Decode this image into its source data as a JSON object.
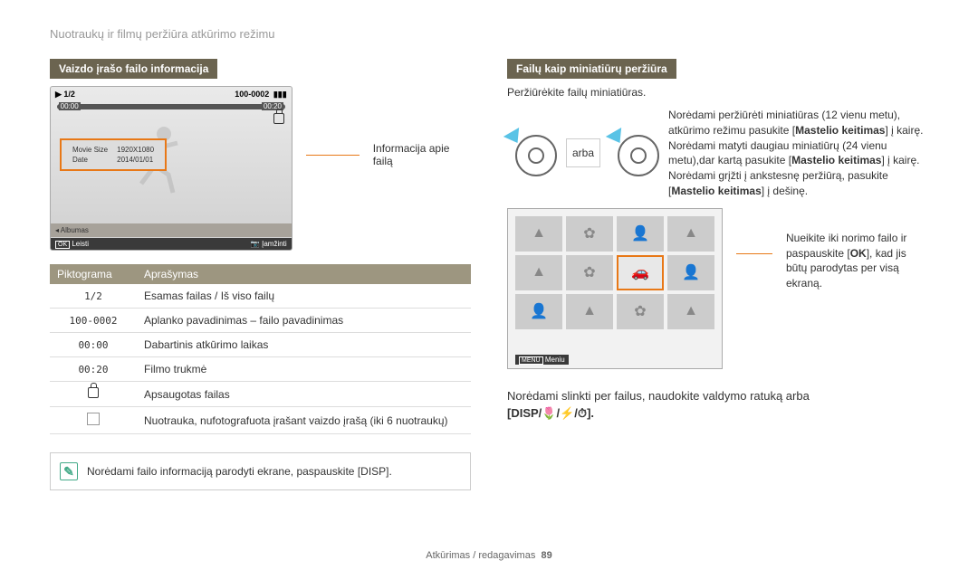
{
  "breadcrumb": "Nuotraukų ir filmų peržiūra atkūrimo režimu",
  "left": {
    "title": "Vaizdo įrašo failo informacija",
    "lcd": {
      "counter": "1/2",
      "file": "100-0002",
      "time_l": "00:00",
      "time_r": "00:20",
      "info_size_label": "Movie Size",
      "info_size_val": "1920X1080",
      "info_date_label": "Date",
      "info_date_val": "2014/01/01",
      "album": "Albumas",
      "play": "Leisti",
      "capture": "Įamžinti"
    },
    "leader": "Informacija apie failą",
    "table": {
      "h1": "Piktograma",
      "h2": "Aprašymas",
      "rows": [
        {
          "icon": "1/2",
          "desc": "Esamas failas / Iš viso failų"
        },
        {
          "icon": "100-0002",
          "desc": "Aplanko pavadinimas – failo pavadinimas"
        },
        {
          "icon": "00:00",
          "desc": "Dabartinis atkūrimo laikas"
        },
        {
          "icon": "00:20",
          "desc": "Filmo trukmė"
        },
        {
          "icon": "lock",
          "desc": "Apsaugotas failas"
        },
        {
          "icon": "photo",
          "desc": "Nuotrauka, nufotografuota įrašant vaizdo įrašą (iki 6 nuotraukų)"
        }
      ]
    },
    "note": "Norėdami failo informaciją parodyti ekrane, paspauskite [DISP]."
  },
  "right": {
    "title": "Failų kaip miniatiūrų peržiūra",
    "sub": "Peržiūrėkite failų miniatiūras.",
    "arba": "arba",
    "para1": "Norėdami peržiūrėti miniatiūras (12 vienu metu), atkūrimo režimu pasukite [",
    "para1b": "Mastelio keitimas",
    "para1c": "] į kairę. Norėdami matyti daugiau miniatiūrų (24 vienu metu),dar kartą pasukite [",
    "para1d": "Mastelio keitimas",
    "para1e": "] į kairę. Norėdami grįžti į ankstesnę peržiūrą, pasukite [",
    "para1f": "Mastelio keitimas",
    "para1g": "] į dešinę.",
    "thumb_menu": "Meniu",
    "thumb_caption_a": "Nueikite iki norimo failo ir paspauskite [",
    "thumb_caption_b": "OK",
    "thumb_caption_c": "], kad jis būtų parodytas per visą ekraną.",
    "bottom_a": "Norėdami slinkti per failus, naudokite valdymo ratuką arba",
    "bottom_b": "[DISP/",
    "bottom_c": "/",
    "bottom_d": "/",
    "bottom_e": "]."
  },
  "footer": {
    "section": "Atkūrimas / redagavimas",
    "page": "89"
  }
}
